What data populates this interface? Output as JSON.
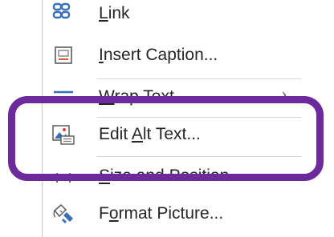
{
  "menu": {
    "items": [
      {
        "label_plain": "Link",
        "accel": "L",
        "pre": "",
        "post": "ink"
      },
      {
        "pre": "",
        "accel": "I",
        "post": "nsert Caption..."
      },
      {
        "pre": "",
        "accel": "W",
        "post": "rap Text",
        "has_submenu": true
      },
      {
        "pre": "Edit ",
        "accel": "A",
        "post": "lt Text..."
      },
      {
        "pre": "",
        "accel": "S",
        "post": "ize and Position..."
      },
      {
        "pre": "F",
        "accel": "o",
        "post": "rmat Picture..."
      }
    ]
  },
  "icons": {
    "link": "link-chain-icon",
    "caption": "insert-caption-icon",
    "wrap": "wrap-text-icon",
    "alt": "alt-text-icon",
    "size": "size-position-icon",
    "format": "format-picture-icon"
  },
  "colors": {
    "highlight": "#6c2a9c",
    "icon_blue": "#3a6fb5",
    "icon_red": "#d9432f",
    "text": "#262626"
  },
  "glyphs": {
    "chevron": "›"
  }
}
